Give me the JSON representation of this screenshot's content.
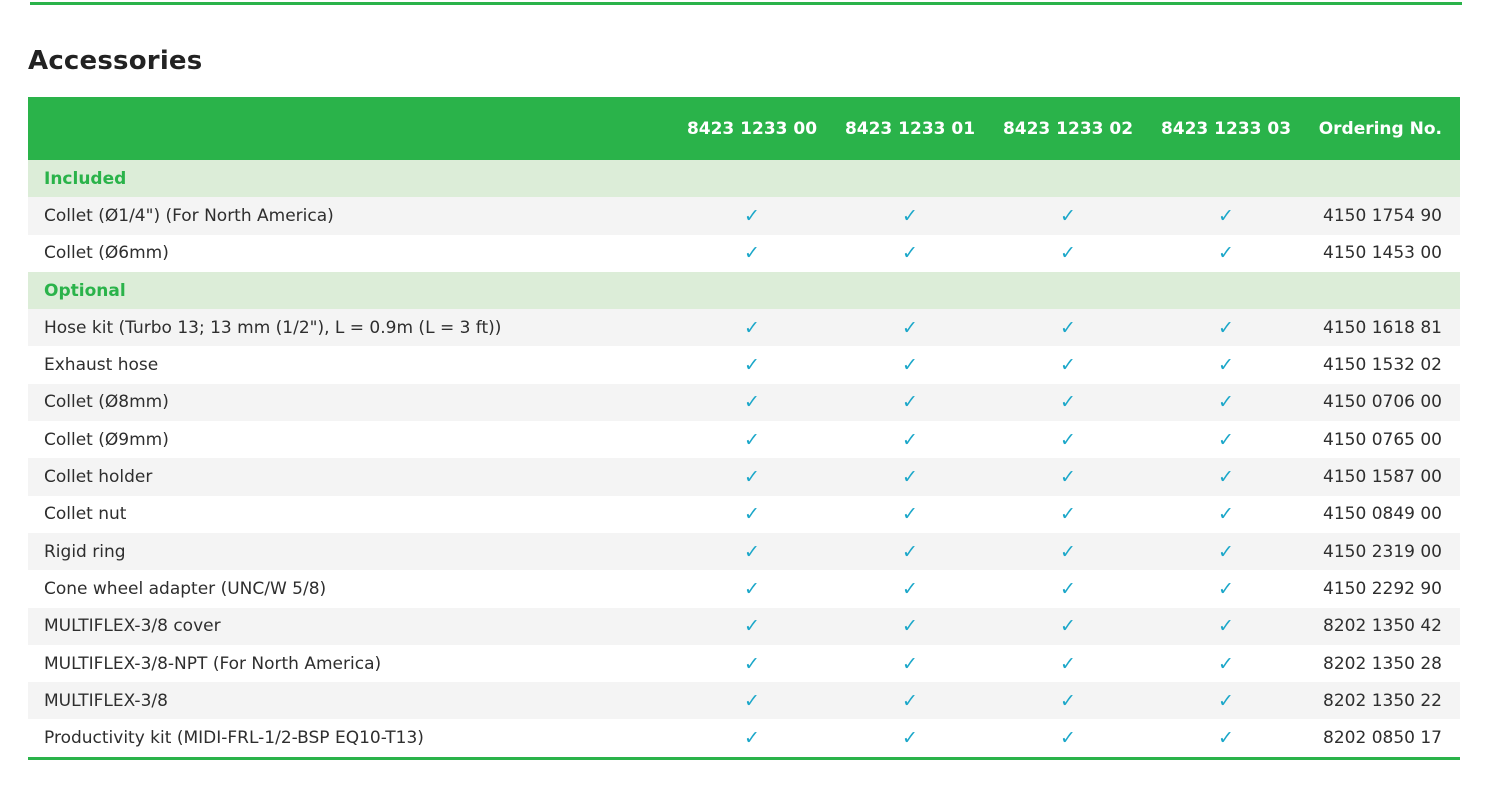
{
  "section": {
    "title": "Accessories"
  },
  "table": {
    "headers": [
      "",
      "8423 1233 00",
      "8423 1233 01",
      "8423 1233 02",
      "8423 1233 03",
      "Ordering No."
    ],
    "check_symbol": "✓",
    "groups": [
      {
        "label": "Included",
        "rows": [
          {
            "description": "Collet (Ø1/4\")  (For North America)",
            "order_no": "4150 1754 90"
          },
          {
            "description": "Collet (Ø6mm)",
            "order_no": "4150 1453 00"
          }
        ]
      },
      {
        "label": "Optional",
        "rows": [
          {
            "description": "Hose kit (Turbo 13; 13 mm (1/2\"), L = 0.9m (L = 3 ft))",
            "order_no": "4150 1618 81"
          },
          {
            "description": "Exhaust hose",
            "order_no": "4150 1532 02"
          },
          {
            "description": "Collet (Ø8mm)",
            "order_no": "4150 0706 00"
          },
          {
            "description": "Collet (Ø9mm)",
            "order_no": "4150 0765 00"
          },
          {
            "description": "Collet holder",
            "order_no": "4150 1587 00"
          },
          {
            "description": "Collet nut",
            "order_no": "4150 0849 00"
          },
          {
            "description": "Rigid ring",
            "order_no": "4150 2319 00"
          },
          {
            "description": "Cone wheel adapter (UNC/W  5/8)",
            "order_no": "4150 2292 90"
          },
          {
            "description": "MULTIFLEX-3/8 cover",
            "order_no": "8202 1350 42"
          },
          {
            "description": "MULTIFLEX-3/8-NPT (For North America)",
            "order_no": "8202 1350 28"
          },
          {
            "description": "MULTIFLEX-3/8",
            "order_no": "8202 1350 22"
          },
          {
            "description": "Productivity kit (MIDI-FRL-1/2-BSP EQ10-T13)",
            "order_no": "8202 0850 17"
          }
        ]
      }
    ]
  },
  "colors": {
    "brand_green": "#2ab34a",
    "group_band": "#dcedd8",
    "check": "#1ba7c9"
  }
}
